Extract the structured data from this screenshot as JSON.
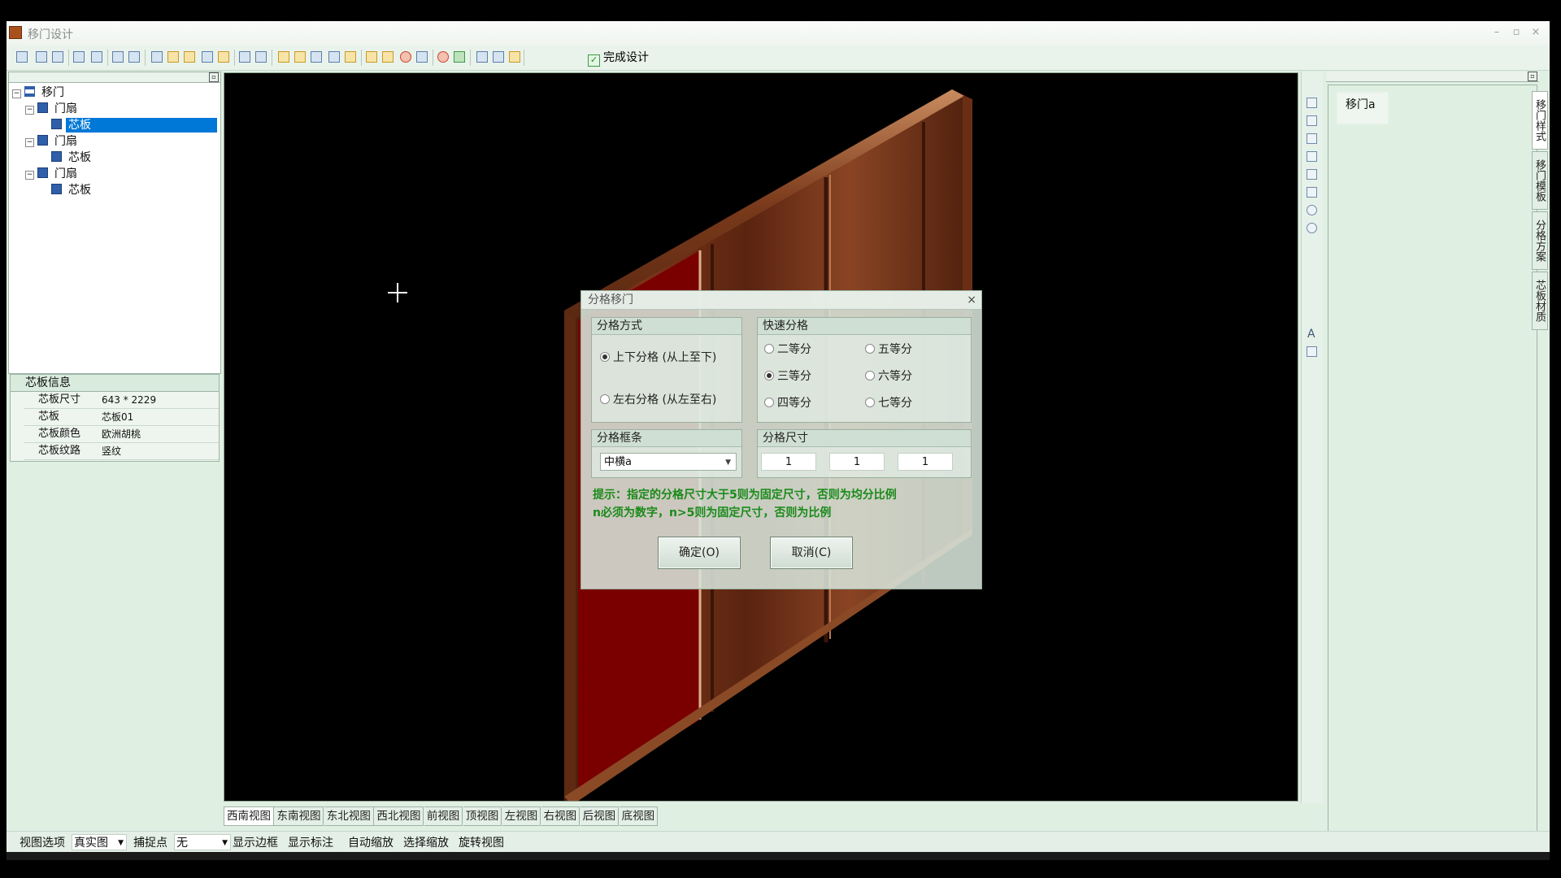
{
  "window": {
    "title": "移门设计",
    "minimize": "–",
    "restore": "▫",
    "close": "×"
  },
  "toolbar": {
    "finish_label": "完成设计"
  },
  "tree": {
    "root": "移门",
    "nodes": [
      {
        "label": "门扇",
        "child": "芯板"
      },
      {
        "label": "门扇",
        "child": "芯板"
      },
      {
        "label": "门扇",
        "child": "芯板"
      }
    ]
  },
  "info": {
    "title": "芯板信息",
    "rows": [
      {
        "key": "芯板尺寸",
        "value": "643 * 2229"
      },
      {
        "key": "芯板",
        "value": "芯板01"
      },
      {
        "key": "芯板颜色",
        "value": "欧洲胡桃"
      },
      {
        "key": "芯板纹路",
        "value": "竖纹"
      }
    ]
  },
  "style_panel": {
    "item": "移门a"
  },
  "side_tabs": [
    "移门样式",
    "移门模板",
    "分格方案",
    "芯板材质"
  ],
  "right_tools": {
    "text_tool": "A"
  },
  "view_tabs": [
    "西南视图",
    "东南视图",
    "东北视图",
    "西北视图",
    "前视图",
    "顶视图",
    "左视图",
    "右视图",
    "后视图",
    "底视图"
  ],
  "status": {
    "view_options": "视图选项",
    "render_mode": "真实图",
    "snap_label": "捕捉点",
    "snap_value": "无",
    "show_frame": "显示边框",
    "show_dims": "显示标注",
    "auto_zoom": "自动缩放",
    "select_zoom": "选择缩放",
    "rotate_view": "旋转视图"
  },
  "dialog": {
    "title": "分格移门",
    "close": "×",
    "split_mode": {
      "title": "分格方式",
      "options": [
        "上下分格 (从上至下)",
        "左右分格 (从左至右)"
      ],
      "selected": 0
    },
    "quick_split": {
      "title": "快速分格",
      "options": [
        "二等分",
        "五等分",
        "三等分",
        "六等分",
        "四等分",
        "七等分"
      ],
      "selected": "三等分"
    },
    "split_bar": {
      "title": "分格框条",
      "value": "中横a"
    },
    "split_size": {
      "title": "分格尺寸",
      "values": [
        "1",
        "1",
        "1"
      ]
    },
    "hint1": "提示：指定的分格尺寸大于5则为固定尺寸，否则为均分比例",
    "hint2": "n必须为数字，n>5则为固定尺寸，否则为比例",
    "ok_label": "确定(O)",
    "cancel_label": "取消(C)"
  },
  "colors": {
    "accent": "#0078d7",
    "panel_bg": "#dff0e3",
    "hint_green": "#1a8a1a",
    "door_wood": "#6b2c12",
    "door_red": "#8b0000"
  }
}
